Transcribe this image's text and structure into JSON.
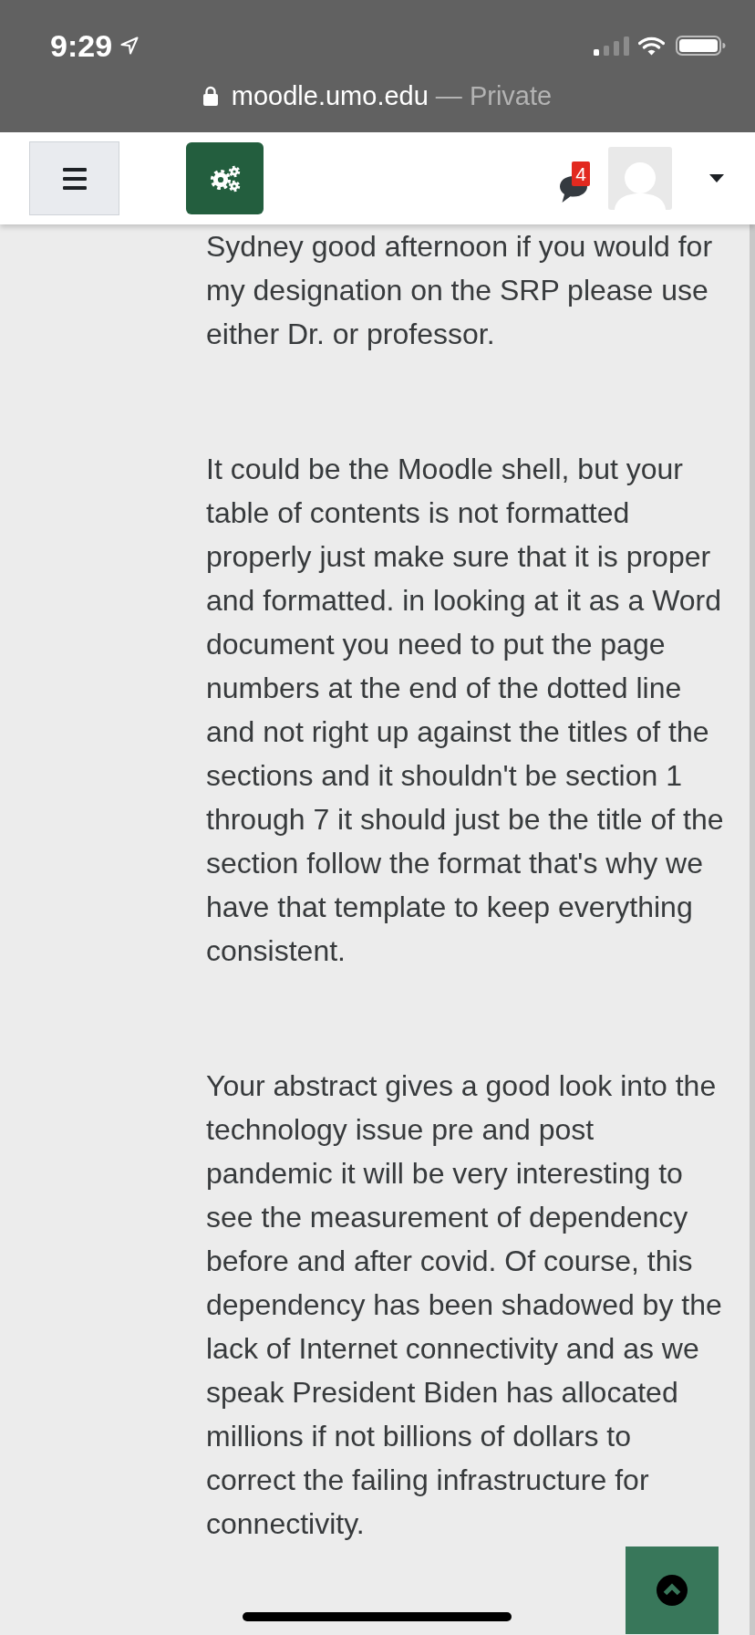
{
  "status_bar": {
    "time": "9:29"
  },
  "address_bar": {
    "domain": "moodle.umo.edu",
    "mode": "— Private"
  },
  "navbar": {
    "notification_count": "4"
  },
  "feedback_paragraphs": [
    "Sydney good afternoon if you would for my designation on the SRP please use either Dr. or professor.",
    "It could be the Moodle shell, but your table of contents is not formatted properly just make sure that it is proper and formatted. in looking at it as a Word document you need to put the page numbers at the end of the dotted line and not right up against the titles of the sections and it shouldn't be section 1 through 7 it should just be the title of the section follow the format that's why we have that template to keep everything consistent.",
    "Your abstract gives a good look into the technology issue pre and post pandemic it will be very interesting to see the measurement of dependency before and after covid. Of course, this dependency has been shadowed by the lack of Internet connectivity and as we speak President Biden has allocated millions if not billions of dollars to correct the failing infrastructure for connectivity."
  ]
}
